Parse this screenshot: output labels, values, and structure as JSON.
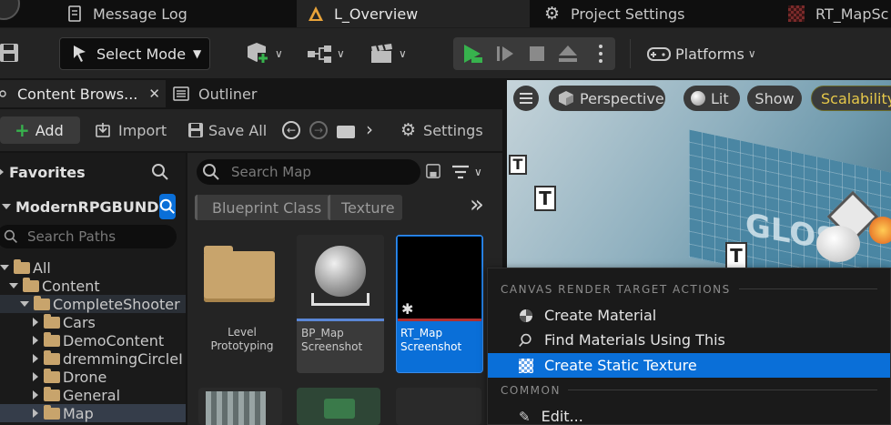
{
  "tabs": [
    {
      "label": "Message Log",
      "icon": "document-icon"
    },
    {
      "label": "L_Overview",
      "icon": "level-icon"
    },
    {
      "label": "Project Settings",
      "icon": "gear-icon"
    },
    {
      "label": "RT_MapSc",
      "icon": "render-target-icon"
    }
  ],
  "toolbar": {
    "select_mode": "Select Mode",
    "platforms": "Platforms"
  },
  "content_browser": {
    "tab_label": "Content Brows...",
    "outliner_label": "Outliner",
    "add": "Add",
    "import": "Import",
    "save_all": "Save All",
    "settings": "Settings",
    "favorites": "Favorites",
    "project": "ModernRPGBUND",
    "search_paths_placeholder": "Search Paths",
    "search_map_placeholder": "Search Map",
    "filters": [
      "Blueprint Class",
      "Texture"
    ],
    "tree": [
      {
        "label": "All",
        "expanded": true
      },
      {
        "label": "Content",
        "expanded": true
      },
      {
        "label": "CompleteShooter",
        "expanded": true
      },
      {
        "label": "Cars",
        "expanded": false
      },
      {
        "label": "DemoContent",
        "expanded": false
      },
      {
        "label": "dremmingCircleI",
        "expanded": false
      },
      {
        "label": "Drone",
        "expanded": false
      },
      {
        "label": "General",
        "expanded": false
      },
      {
        "label": "Map",
        "expanded": false,
        "selected": true
      }
    ],
    "assets": [
      {
        "label": "Level Prototyping"
      },
      {
        "label": "BP_Map Screenshot"
      },
      {
        "label": "RT_Map Screenshot"
      }
    ]
  },
  "viewport": {
    "perspective": "Perspective",
    "lit": "Lit",
    "show": "Show",
    "scalability": "Scalability"
  },
  "context_menu": {
    "section1": "CANVAS RENDER TARGET ACTIONS",
    "items1": [
      {
        "label": "Create Material",
        "icon": "material-icon"
      },
      {
        "label": "Find Materials Using This",
        "icon": "search-icon"
      },
      {
        "label": "Create Static Texture",
        "icon": "texture-icon",
        "selected": true
      }
    ],
    "section2": "COMMON",
    "items2": [
      {
        "label": "Edit...",
        "icon": "edit-icon"
      }
    ]
  },
  "colors": {
    "accent_blue": "#0a6fd8",
    "play_green": "#37b24d",
    "folder": "#c8a46c",
    "scalability_yellow": "#e6c84a"
  }
}
